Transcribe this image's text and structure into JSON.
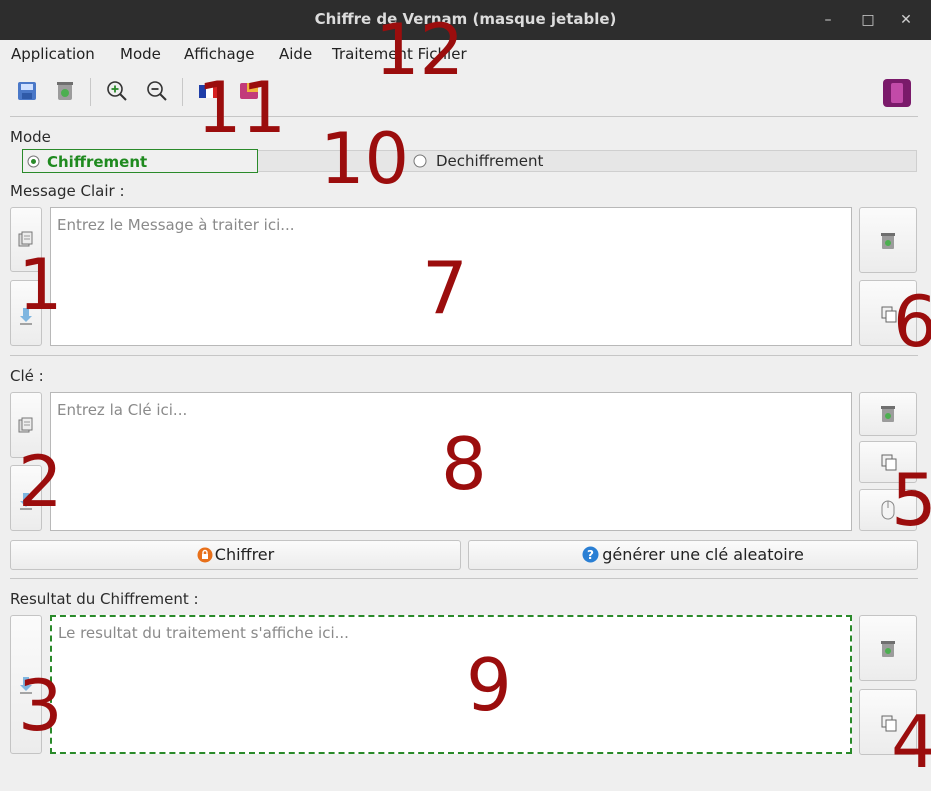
{
  "window": {
    "title": "Chiffre de Vernam (masque jetable)"
  },
  "menu": {
    "items": [
      "Application",
      "Mode",
      "Affichage",
      "Aide",
      "Traitement Fichier"
    ]
  },
  "mode": {
    "label": "Mode",
    "options": [
      "Chiffrement",
      "Dechiffrement"
    ],
    "selected": "Chiffrement"
  },
  "message": {
    "label": "Message Clair :",
    "placeholder": "Entrez le Message à traiter ici..."
  },
  "key": {
    "label": "Clé :",
    "placeholder": "Entrez la Clé ici..."
  },
  "actions": {
    "encrypt_label": "Chiffrer",
    "generate_label": "générer une clé aleatoire"
  },
  "result": {
    "label": "Resultat du Chiffrement :",
    "placeholder": "Le resultat du traitement s'affiche ici..."
  },
  "annotations": [
    "1",
    "2",
    "3",
    "4",
    "5",
    "6",
    "7",
    "8",
    "9",
    "10",
    "11",
    "12"
  ],
  "colors": {
    "annotation": "#9b0d0d",
    "selected_mode": "#1f8a1f",
    "result_border": "#2a8a2a",
    "titlebar": "#2d2d2d"
  }
}
